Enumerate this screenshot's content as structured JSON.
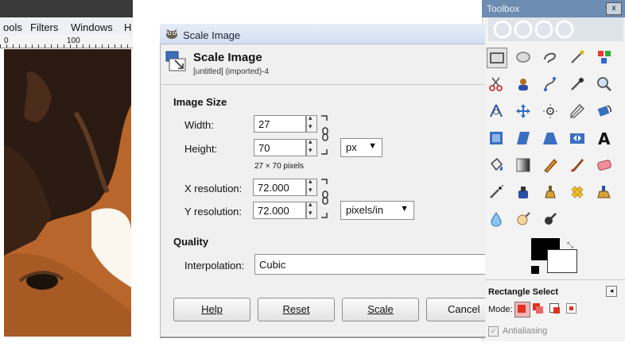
{
  "image_window": {
    "menus": [
      "ools",
      "Filters",
      "Windows",
      "H"
    ],
    "ruler_labels": [
      "0",
      "100"
    ]
  },
  "dialog": {
    "title": "Scale Image",
    "header_title": "Scale Image",
    "header_subtitle": "[untitled] (imported)-4",
    "image_size_section": "Image Size",
    "width_label": "Width:",
    "width_value": "27",
    "height_label": "Height:",
    "height_value": "70",
    "size_unit": "px",
    "pixel_info": "27 × 70 pixels",
    "xres_label": "X resolution:",
    "xres_value": "72.000",
    "yres_label": "Y resolution:",
    "yres_value": "72.000",
    "res_unit": "pixels/in",
    "quality_section": "Quality",
    "interp_label": "Interpolation:",
    "interp_value": "Cubic",
    "buttons": {
      "help": "Help",
      "reset": "Reset",
      "scale": "Scale",
      "cancel": "Cancel"
    }
  },
  "toolbox": {
    "title": "Toolbox",
    "options_title": "Rectangle Select",
    "mode_label": "Mode:",
    "antialiasing": "Antialiasing",
    "colors": {
      "foreground": "#000000",
      "background": "#ffffff"
    }
  }
}
